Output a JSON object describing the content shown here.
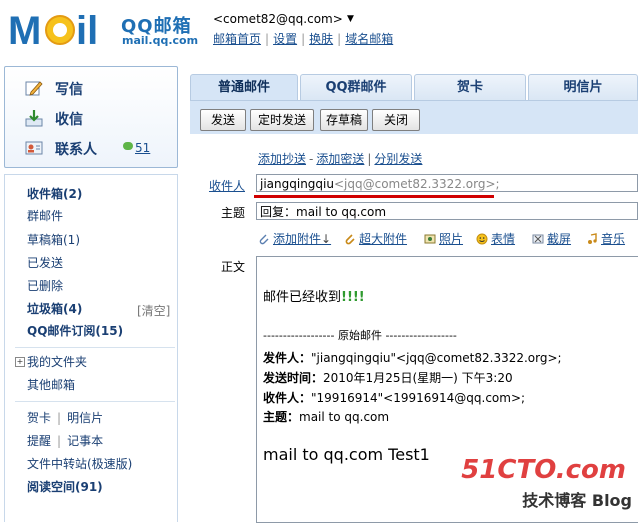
{
  "header": {
    "logo_brand": "QQ邮箱",
    "logo_url": "mail.qq.com",
    "user_email": "<comet82@qq.com>",
    "dropdown_glyph": "▼",
    "links": [
      "邮箱首页",
      "设置",
      "换肤",
      "域名邮箱"
    ]
  },
  "sidebar": {
    "actions": {
      "write": "写信",
      "inbox": "收信",
      "contacts": "联系人",
      "contacts_count": "51"
    },
    "folders": [
      "收件箱(2)",
      "群邮件",
      "草稿箱(1)",
      "已发送",
      "已删除",
      "垃圾箱(4)",
      "QQ邮件订阅(15)"
    ],
    "clear_label": "[清空]",
    "my_folders": "我的文件夹",
    "other_mail": "其他邮箱",
    "card_links": [
      "贺卡",
      "明信片"
    ],
    "note_links": [
      "提醒",
      "记事本"
    ],
    "file_transfer": "文件中转站(极速版)",
    "reading_space": "阅读空间(91)"
  },
  "tabs": [
    "普通邮件",
    "QQ群邮件",
    "贺卡",
    "明信片"
  ],
  "toolbar": {
    "send": "发送",
    "timed_send": "定时发送",
    "save_draft": "存草稿",
    "close": "关闭"
  },
  "compose": {
    "add_cc": "添加抄送",
    "add_bcc": "添加密送",
    "separate_send": "分别发送",
    "to_label": "收件人",
    "to_name": "jiangqingqiu",
    "to_email": "<jqq@comet82.3322.org>;",
    "subject_label": "主题",
    "subject_value": "回复：mail to qq.com",
    "body_label": "正文",
    "attachments": {
      "add_attachment": "添加附件",
      "large_attachment": "超大附件",
      "photo": "照片",
      "emoji": "表情",
      "screenshot": "截屏",
      "music": "音乐"
    },
    "body": {
      "line1": "邮件已经收到",
      "line1_suffix": "!!!!",
      "divider": "------------------ 原始邮件 ------------------",
      "from_label": "发件人：",
      "from_value": "\"jiangqingqiu\"<jqq@comet82.3322.org>;",
      "time_label": "发送时间：",
      "time_value": "2010年1月25日(星期一) 下午3:20",
      "to_label": "收件人：",
      "to_value": "\"19916914\"<19916914@qq.com>;",
      "subject_label": "主题：",
      "subject_value": "mail to qq.com",
      "big_text": "mail to qq.com Test1"
    }
  },
  "watermark": {
    "site": "51CTO.com",
    "blog": "技术博客 Blog"
  },
  "colors": {
    "brand_blue": "#1f6fb4",
    "link_blue": "#1a4f8f",
    "tab_bg": "#d6e5f6",
    "highlight_red": "#d00000",
    "green_text": "#2f9a2f"
  }
}
